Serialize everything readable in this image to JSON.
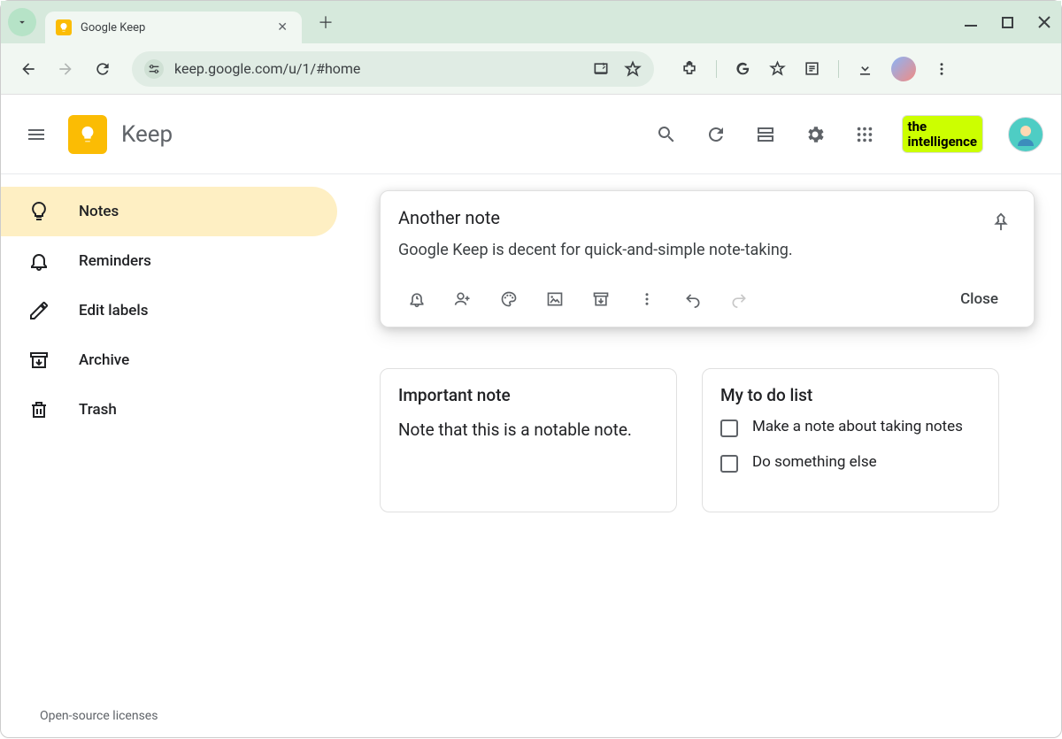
{
  "browser": {
    "tab_title": "Google Keep",
    "url": "keep.google.com/u/1/#home"
  },
  "app": {
    "title": "Keep",
    "badge_line1": "the",
    "badge_line2": "intelligence"
  },
  "sidebar": {
    "items": [
      {
        "label": "Notes"
      },
      {
        "label": "Reminders"
      },
      {
        "label": "Edit labels"
      },
      {
        "label": "Archive"
      },
      {
        "label": "Trash"
      }
    ]
  },
  "editor": {
    "title": "Another note",
    "body": "Google Keep is decent for quick-and-simple note-taking.",
    "close_label": "Close"
  },
  "cards": [
    {
      "title": "Important note",
      "body": "Note that this is a notable note."
    },
    {
      "title": "My to do list",
      "todos": [
        "Make a note about taking notes",
        "Do something else"
      ]
    }
  ],
  "footer": {
    "licenses": "Open-source licenses"
  }
}
